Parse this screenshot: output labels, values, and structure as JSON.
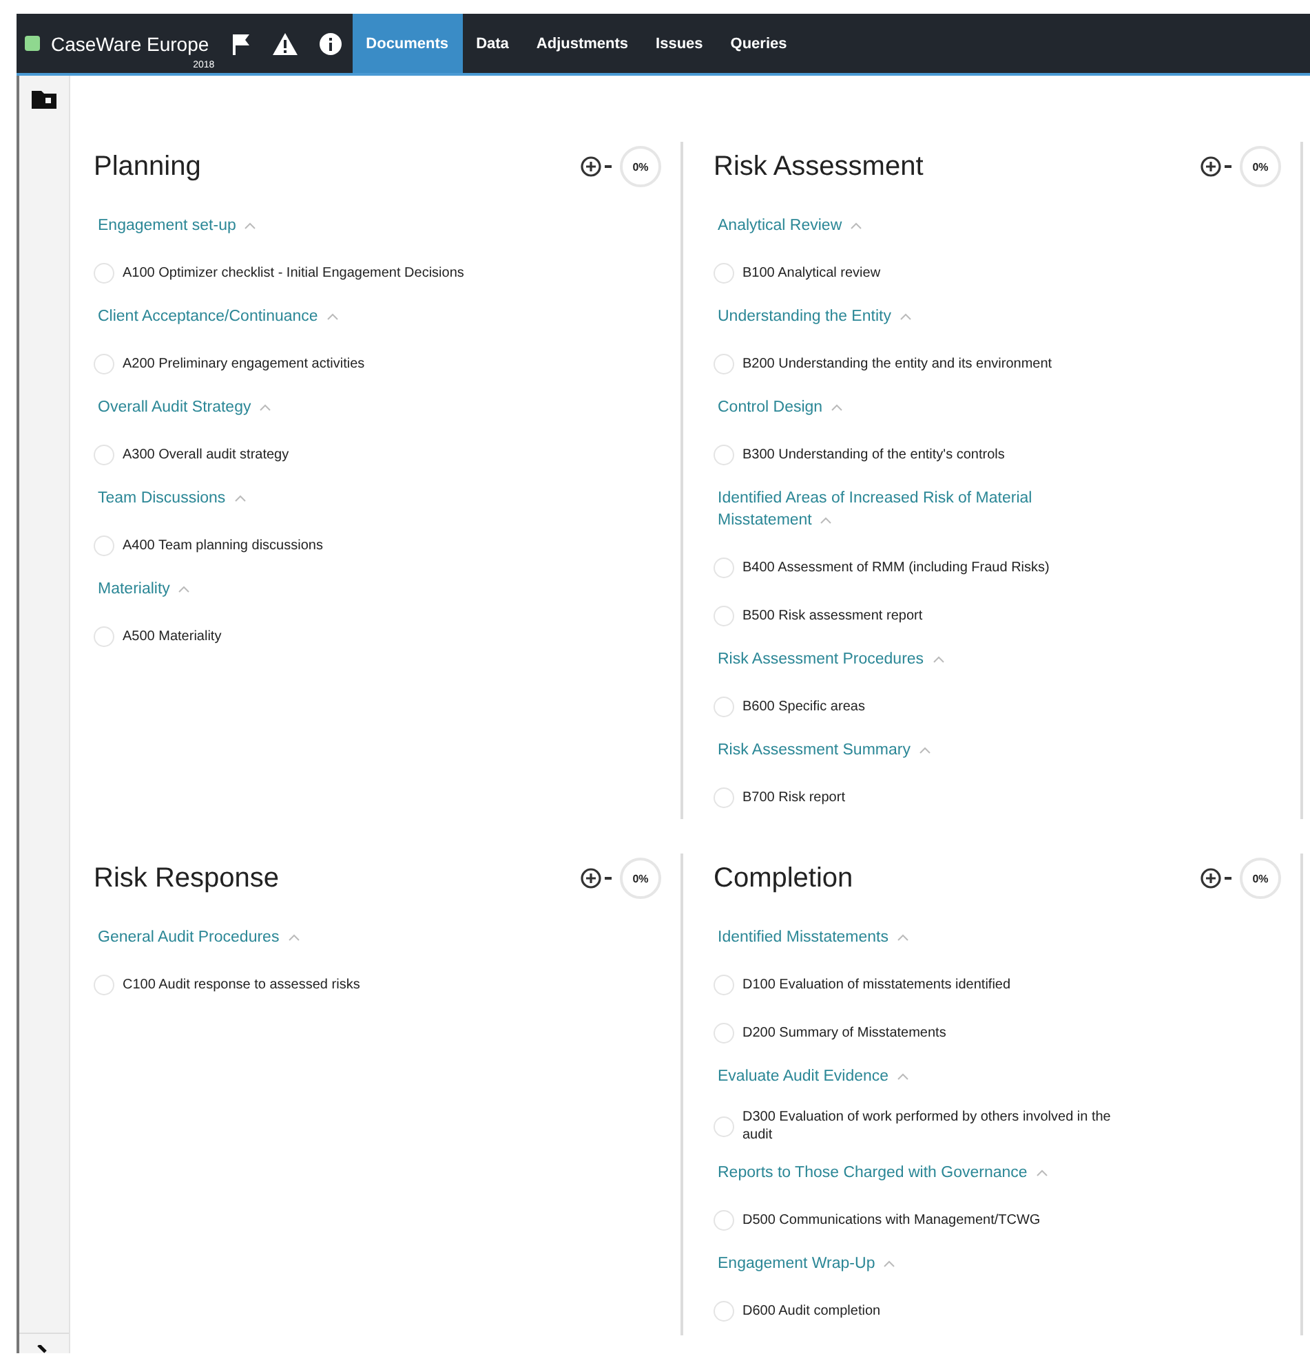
{
  "nav": {
    "brand": "CaseWare Europe",
    "brand_year": "2018",
    "tabs": [
      {
        "label": "Documents",
        "selected": true
      },
      {
        "label": "Data",
        "selected": false
      },
      {
        "label": "Adjustments",
        "selected": false
      },
      {
        "label": "Issues",
        "selected": false
      },
      {
        "label": "Queries",
        "selected": false
      }
    ]
  },
  "panels": [
    {
      "title": "Planning",
      "progress": "0%",
      "sections": [
        {
          "title": "Engagement set-up",
          "expanded": true,
          "items": [
            {
              "label": "A100 Optimizer checklist - Initial Engagement Decisions",
              "completed": false
            }
          ]
        },
        {
          "title": "Client Acceptance/Continuance",
          "expanded": true,
          "items": [
            {
              "label": "A200 Preliminary engagement activities",
              "completed": false
            }
          ]
        },
        {
          "title": "Overall Audit Strategy",
          "expanded": true,
          "items": [
            {
              "label": "A300 Overall audit strategy",
              "completed": false
            }
          ]
        },
        {
          "title": "Team Discussions",
          "expanded": true,
          "items": [
            {
              "label": "A400 Team planning discussions",
              "completed": false
            }
          ]
        },
        {
          "title": "Materiality",
          "expanded": true,
          "items": [
            {
              "label": "A500 Materiality",
              "completed": false
            }
          ]
        }
      ]
    },
    {
      "title": "Risk Assessment",
      "progress": "0%",
      "sections": [
        {
          "title": "Analytical Review",
          "expanded": true,
          "items": [
            {
              "label": "B100 Analytical review",
              "completed": false
            }
          ]
        },
        {
          "title": "Understanding the Entity",
          "expanded": true,
          "items": [
            {
              "label": "B200 Understanding the entity and its environment",
              "completed": false
            }
          ]
        },
        {
          "title": "Control Design",
          "expanded": true,
          "items": [
            {
              "label": "B300 Understanding of the entity's controls",
              "completed": false
            }
          ]
        },
        {
          "title": "Identified Areas of Increased Risk of Material Misstatement",
          "expanded": true,
          "items": [
            {
              "label": "B400 Assessment of RMM (including Fraud Risks)",
              "completed": false
            },
            {
              "label": "B500 Risk assessment report",
              "completed": false
            }
          ]
        },
        {
          "title": "Risk Assessment Procedures",
          "expanded": true,
          "items": [
            {
              "label": "B600 Specific areas",
              "completed": false
            }
          ]
        },
        {
          "title": "Risk Assessment Summary",
          "expanded": true,
          "items": [
            {
              "label": "B700 Risk report",
              "completed": false
            }
          ]
        }
      ]
    },
    {
      "title": "Risk Response",
      "progress": "0%",
      "sections": [
        {
          "title": "General Audit Procedures",
          "expanded": true,
          "items": [
            {
              "label": "C100 Audit response to assessed risks",
              "completed": false
            }
          ]
        }
      ]
    },
    {
      "title": "Completion",
      "progress": "0%",
      "sections": [
        {
          "title": "Identified Misstatements",
          "expanded": true,
          "items": [
            {
              "label": "D100 Evaluation of misstatements identified",
              "completed": false
            },
            {
              "label": "D200 Summary of Misstatements",
              "completed": false
            }
          ]
        },
        {
          "title": "Evaluate Audit Evidence",
          "expanded": true,
          "items": [
            {
              "label": "D300 Evaluation of work performed by others involved in the audit",
              "completed": false
            }
          ]
        },
        {
          "title": "Reports to Those Charged with Governance",
          "expanded": true,
          "items": [
            {
              "label": "D500 Communications with Management/TCWG",
              "completed": false
            }
          ]
        },
        {
          "title": "Engagement Wrap-Up",
          "expanded": true,
          "items": [
            {
              "label": "D600 Audit completion",
              "completed": false
            }
          ]
        }
      ]
    }
  ]
}
